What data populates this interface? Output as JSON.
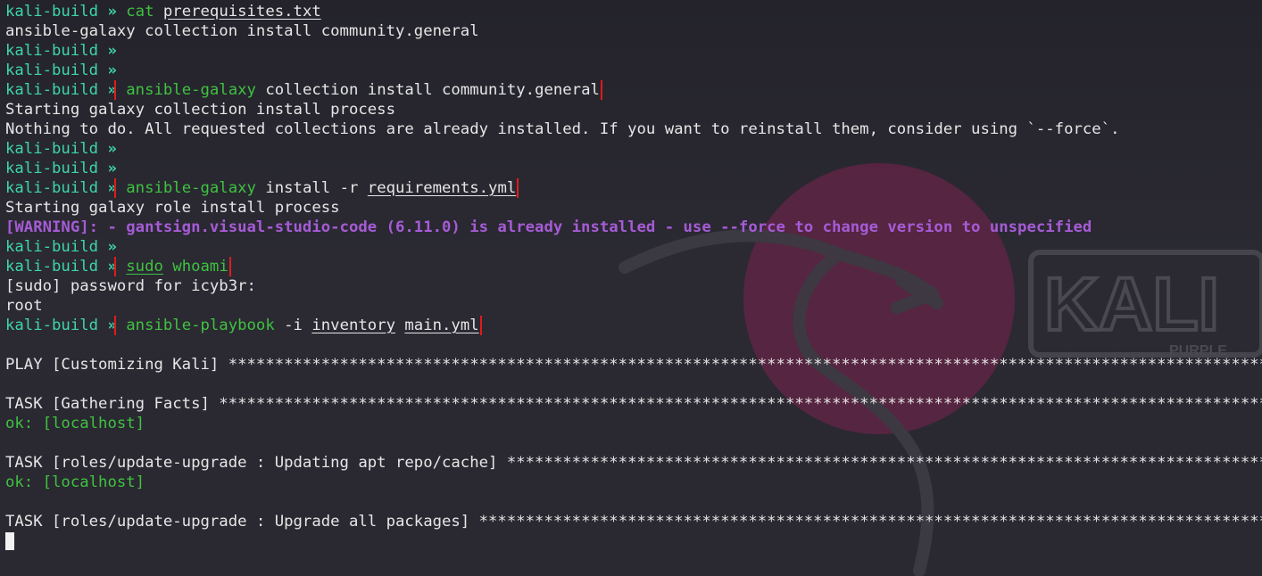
{
  "colors": {
    "background": "#2a2830",
    "prompt": "#3dd6a8",
    "command": "#3fc240",
    "text": "#e6e6e6",
    "warning": "#a65bd6",
    "highlight_box": "#e01b1b",
    "logo_circle": "#6a2546"
  },
  "background": {
    "logo_text": "KALI",
    "logo_subtext": "PURPLE",
    "icons": [
      "kali-dragon-icon"
    ]
  },
  "terminal": {
    "prompt": "kali-build",
    "chevron": "»",
    "stars": "**********************************************************************************************************************",
    "lines": {
      "l1": {
        "cmd": "cat",
        "arg": "prerequisites.txt"
      },
      "l2": {
        "text": "ansible-galaxy collection install community.general"
      },
      "l5": {
        "cmd": "ansible-galaxy",
        "rest": " collection install community.general"
      },
      "l6": {
        "text": "Starting galaxy collection install process"
      },
      "l7": {
        "text": "Nothing to do. All requested collections are already installed. If you want to reinstall them, consider using `--force`."
      },
      "l10": {
        "cmd": "ansible-galaxy",
        "rest": " install -r ",
        "arg": "requirements.yml"
      },
      "l11": {
        "text": "Starting galaxy role install process"
      },
      "l12": {
        "text": "[WARNING]: - gantsign.visual-studio-code (6.11.0) is already installed - use --force to change version to unspecified"
      },
      "l14": {
        "cmd1": "sudo",
        "cmd2": "whoami"
      },
      "l15": {
        "text": "[sudo] password for icyb3r:"
      },
      "l16": {
        "text": "root"
      },
      "l17": {
        "cmd": "ansible-playbook",
        "rest": " -i ",
        "arg1": "inventory",
        "arg2": "main.yml"
      },
      "l19": {
        "text": "PLAY [Customizing Kali] "
      },
      "l21": {
        "text": "TASK [Gathering Facts] "
      },
      "l22": {
        "text": "ok: [localhost]"
      },
      "l24": {
        "text": "TASK [roles/update-upgrade : Updating apt repo/cache] "
      },
      "l25": {
        "text": "ok: [localhost]"
      },
      "l27": {
        "text": "TASK [roles/update-upgrade : Upgrade all packages] "
      }
    }
  }
}
